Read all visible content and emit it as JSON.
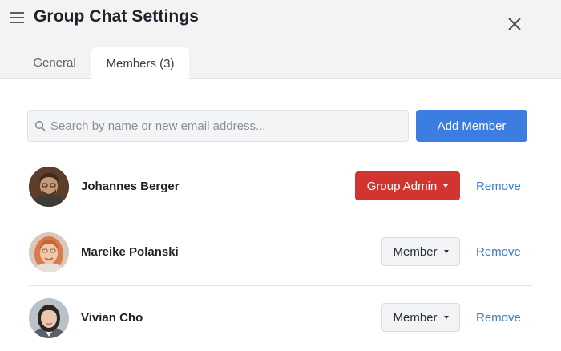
{
  "header": {
    "title": "Group Chat Settings",
    "menu_icon": "hamburger-menu-icon",
    "close_icon": "close-icon"
  },
  "tabs": [
    {
      "label": "General",
      "active": false
    },
    {
      "label": "Members (3)",
      "active": true
    }
  ],
  "search": {
    "placeholder": "Search by name or new email address...",
    "value": ""
  },
  "add_member_label": "Add Member",
  "colors": {
    "accent": "#3b7de0",
    "admin": "#d23430",
    "link": "#3b7dc9",
    "header_bg": "#f3f3f4"
  },
  "members": [
    {
      "name": "Johannes Berger",
      "role": "Group Admin",
      "remove_label": "Remove"
    },
    {
      "name": "Mareike Polanski",
      "role": "Member",
      "remove_label": "Remove"
    },
    {
      "name": "Vivian Cho",
      "role": "Member",
      "remove_label": "Remove"
    }
  ]
}
